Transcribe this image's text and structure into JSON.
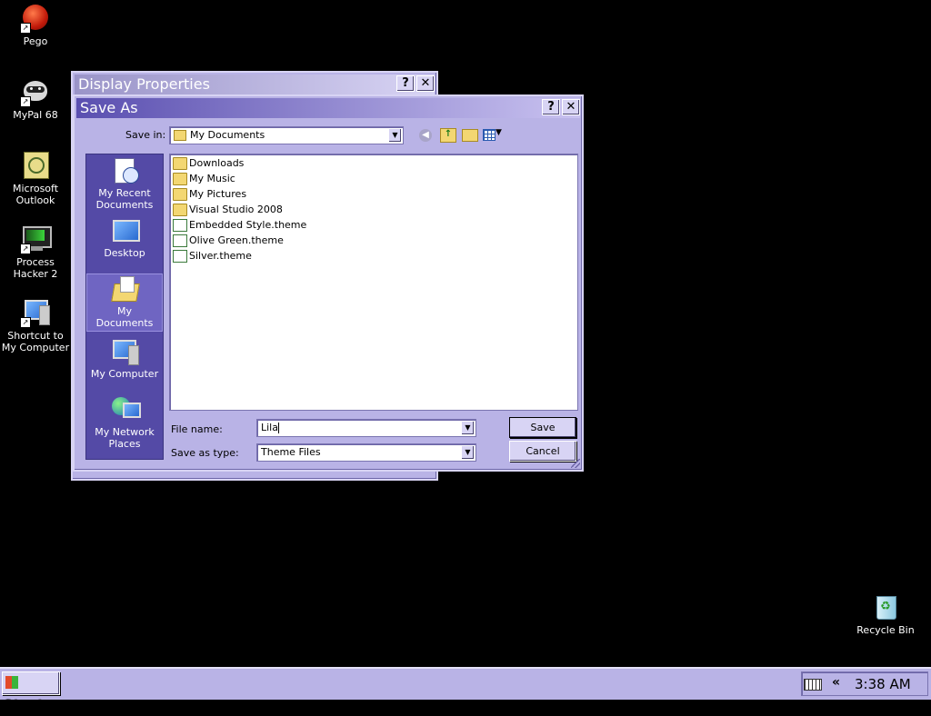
{
  "desktop": {
    "icons": [
      {
        "label": "Pego"
      },
      {
        "label": "MyPal 68"
      },
      {
        "label": "Microsoft Outlook"
      },
      {
        "label": "Process Hacker 2"
      },
      {
        "label": "Shortcut to My Computer"
      },
      {
        "label": "Recycle Bin"
      }
    ]
  },
  "display_properties": {
    "title": "Display Properties",
    "help": "?",
    "close": "✕"
  },
  "save_as": {
    "title": "Save As",
    "help": "?",
    "close": "✕",
    "save_in_label": "Save in:",
    "save_in_value": "My Documents",
    "places": [
      {
        "label": "My Recent Documents"
      },
      {
        "label": "Desktop"
      },
      {
        "label": "My Documents"
      },
      {
        "label": "My Computer"
      },
      {
        "label": "My Network Places"
      }
    ],
    "files": [
      {
        "name": "Downloads",
        "kind": "folder"
      },
      {
        "name": "My Music",
        "kind": "folder"
      },
      {
        "name": "My Pictures",
        "kind": "folder"
      },
      {
        "name": "Visual Studio 2008",
        "kind": "folder"
      },
      {
        "name": "Embedded Style.theme",
        "kind": "theme"
      },
      {
        "name": "Olive Green.theme",
        "kind": "theme"
      },
      {
        "name": "Silver.theme",
        "kind": "theme"
      }
    ],
    "file_name_label": "File name:",
    "file_name_value": "Lila",
    "save_type_label": "Save as type:",
    "save_type_value": "Theme Files",
    "save_button": "Save",
    "cancel_button": "Cancel"
  },
  "taskbar": {
    "start_label": "Start",
    "tray_chevron": "«",
    "clock": "3:38 AM"
  },
  "colors": {
    "title_gradient_start": "#5a4fb0",
    "title_gradient_end": "#c9c2f0",
    "inactive_title_start": "#9a94c8",
    "inactive_title_end": "#d8d4f4",
    "window_face": "#b9b3e6",
    "places_bar": "#544aa6"
  }
}
